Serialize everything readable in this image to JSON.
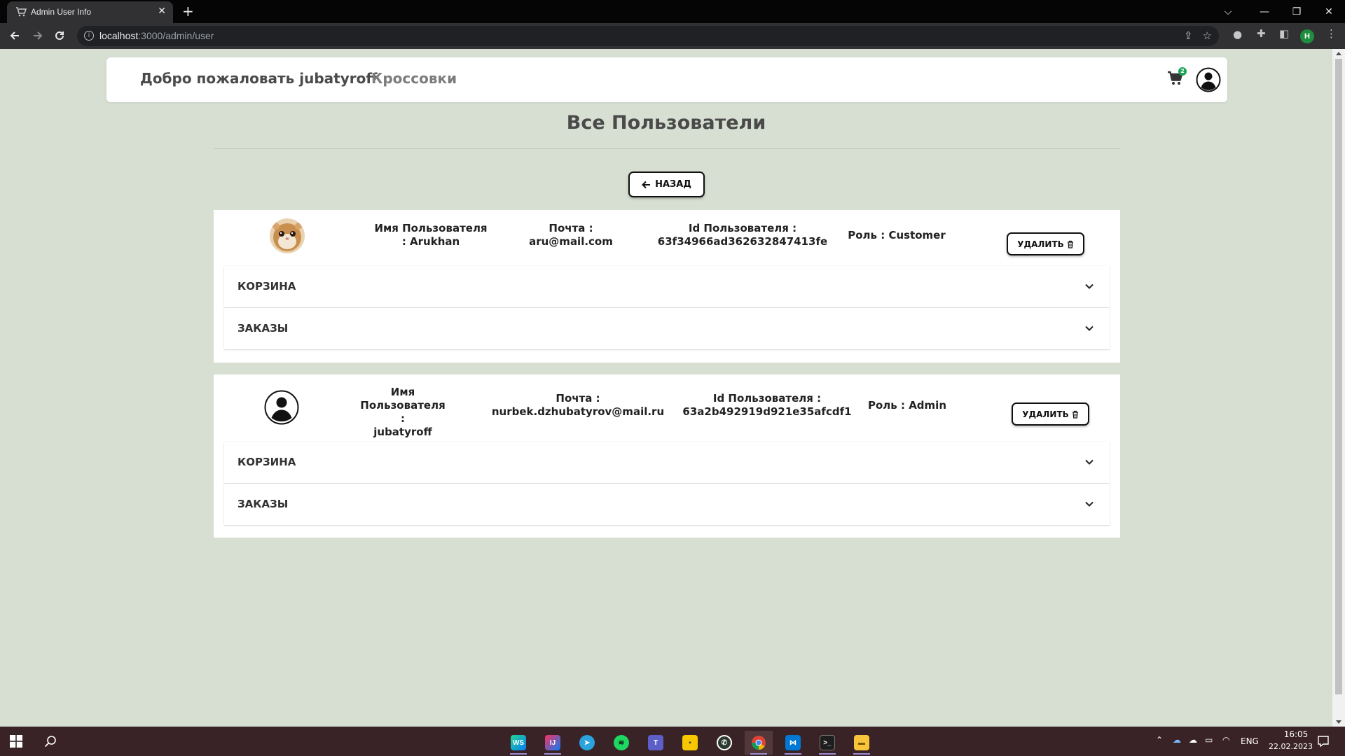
{
  "browser": {
    "tab_title": "Admin User Info",
    "tab_close": "✕",
    "new_tab": "+",
    "url_host": "localhost",
    "url_rest": ":3000/admin/user",
    "profile_initial": "H"
  },
  "navbar": {
    "brand": "Добро пожаловать jubatyroff",
    "link": "Кроссовки",
    "cart_count": "2"
  },
  "page": {
    "title": "Все Пользователи",
    "back_label": "НАЗАД"
  },
  "users": [
    {
      "name_line1": "Имя Пользователя",
      "name_line2": ": Arukhan",
      "email_label": "Почта :",
      "email": "aru@mail.com",
      "id_label": "Id Пользователя :",
      "id": "63f34966ad362632847413fe",
      "role": "Роль : Customer",
      "delete_label": "УДАЛИТЬ",
      "cart_label": "КОРЗИНА",
      "orders_label": "ЗАКАЗЫ"
    },
    {
      "name_line1": "Имя",
      "name_line2": "Пользователя :",
      "name_line3": "jubatyroff",
      "email_label": "Почта :",
      "email": "nurbek.dzhubatyrov@mail.ru",
      "id_label": "Id Пользователя :",
      "id": "63a2b492919d921e35afcdf1",
      "role": "Роль : Admin",
      "delete_label": "УДАЛИТЬ",
      "cart_label": "КОРЗИНА",
      "orders_label": "ЗАКАЗЫ"
    }
  ],
  "taskbar": {
    "apps": [
      "webstorm",
      "intellij",
      "telegram",
      "spotify",
      "teams",
      "sticky-notes",
      "whatsapp",
      "chrome",
      "vscode",
      "terminal",
      "file-explorer"
    ],
    "language": "ENG",
    "time": "16:05",
    "date": "22.02.2023"
  },
  "colors": {
    "page_bg": "#d7dfd2",
    "card_bg": "#ffffff",
    "text": "#4a4a4a",
    "taskbar": "#3a2326"
  }
}
